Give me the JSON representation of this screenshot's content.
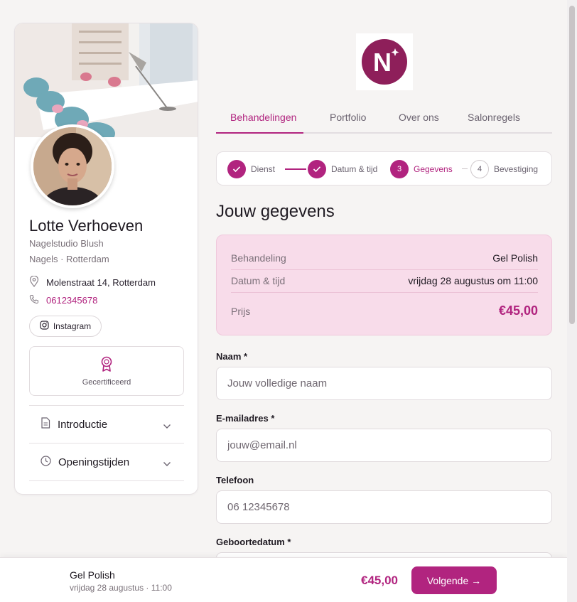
{
  "profile": {
    "name": "Lotte Verhoeven",
    "studio": "Nagelstudio Blush",
    "tagline": "Nagels · Rotterdam",
    "address": "Molenstraat 14, Rotterdam",
    "phone": "0612345678",
    "instagram_label": "Instagram",
    "certified_label": "Gecertificeerd",
    "accordion": [
      {
        "label": "Introductie",
        "icon": "document-icon"
      },
      {
        "label": "Openingstijden",
        "icon": "clock-icon"
      }
    ]
  },
  "logo": {
    "letter": "N"
  },
  "tabs": [
    {
      "label": "Behandelingen",
      "active": true
    },
    {
      "label": "Portfolio",
      "active": false
    },
    {
      "label": "Over ons",
      "active": false
    },
    {
      "label": "Salonregels",
      "active": false
    }
  ],
  "steps": [
    {
      "number": "1",
      "label": "Dienst",
      "state": "done"
    },
    {
      "number": "2",
      "label": "Datum & tijd",
      "state": "done"
    },
    {
      "number": "3",
      "label": "Gegevens",
      "state": "current"
    },
    {
      "number": "4",
      "label": "Bevestiging",
      "state": "upcoming"
    }
  ],
  "page_title": "Jouw gegevens",
  "summary": {
    "treatment_label": "Behandeling",
    "treatment_value": "Gel Polish",
    "datetime_label": "Datum & tijd",
    "datetime_value": "vrijdag 28 augustus om 11:00",
    "price_label": "Prijs",
    "price_value": "€45,00"
  },
  "form": {
    "name_label": "Naam *",
    "name_placeholder": "Jouw volledige naam",
    "email_label": "E-mailadres *",
    "email_placeholder": "jouw@email.nl",
    "phone_label": "Telefoon",
    "phone_placeholder": "06 12345678",
    "birthdate_label": "Geboortedatum *"
  },
  "bottom_bar": {
    "title": "Gel Polish",
    "subtitle": "vrijdag 28 augustus · 11:00",
    "price": "€45,00",
    "button_label": "Volgende →"
  },
  "colors": {
    "accent": "#b1247f",
    "summary_bg": "#f8dcea",
    "page_bg": "#f6f4f3"
  }
}
